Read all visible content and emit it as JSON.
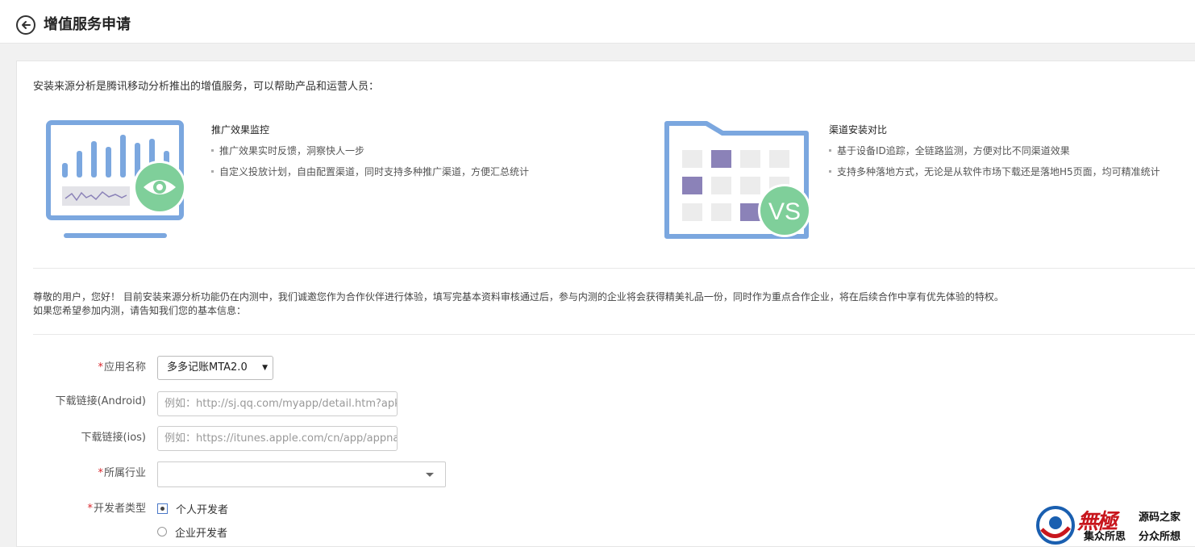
{
  "header": {
    "title": "增值服务申请"
  },
  "intro": "安装来源分析是腾讯移动分析推出的增值服务，可以帮助产品和运营人员：",
  "features": [
    {
      "title": "推广效果监控",
      "items": [
        "推广效果实时反馈，洞察快人一步",
        "自定义投放计划，自由配置渠道，同时支持多种推广渠道，方便汇总统计"
      ]
    },
    {
      "title": "渠道安装对比",
      "items": [
        "基于设备ID追踪，全链路监测，方便对比不同渠道效果",
        "支持多种落地方式，无论是从软件市场下载还是落地H5页面，均可精准统计"
      ],
      "badge": "VS"
    }
  ],
  "notice": {
    "line1": "尊敬的用户，您好！ 目前安装来源分析功能仍在内测中，我们诚邀您作为合作伙伴进行体验，填写完基本资料审核通过后，参与内测的企业将会获得精美礼品一份，同时作为重点合作企业，将在后续合作中享有优先体验的特权。",
    "line2": "如果您希望参加内测，请告知我们您的基本信息："
  },
  "form": {
    "required_mark": "*",
    "app_name": {
      "label": "应用名称",
      "value": "多多记账MTA2.0"
    },
    "android": {
      "label": "下载链接(Android)",
      "placeholder": "例如：http://sj.qq.com/myapp/detail.htm?apkName="
    },
    "ios": {
      "label": "下载链接(ios)",
      "placeholder": "例如：https://itunes.apple.com/cn/app/appname"
    },
    "industry": {
      "label": "所属行业",
      "value": ""
    },
    "dev_type": {
      "label": "开发者类型",
      "options": [
        "个人开发者",
        "企业开发者"
      ],
      "selected": "个人开发者"
    }
  },
  "watermark": {
    "brand": "無極",
    "site": "源码之家",
    "slogan1": "集众所思",
    "slogan2": "分众所想"
  },
  "colors": {
    "chart_blue": "#7ba7df",
    "eye_green": "#7fcf9a",
    "purple": "#8b82b8",
    "required": "#d9252b"
  }
}
